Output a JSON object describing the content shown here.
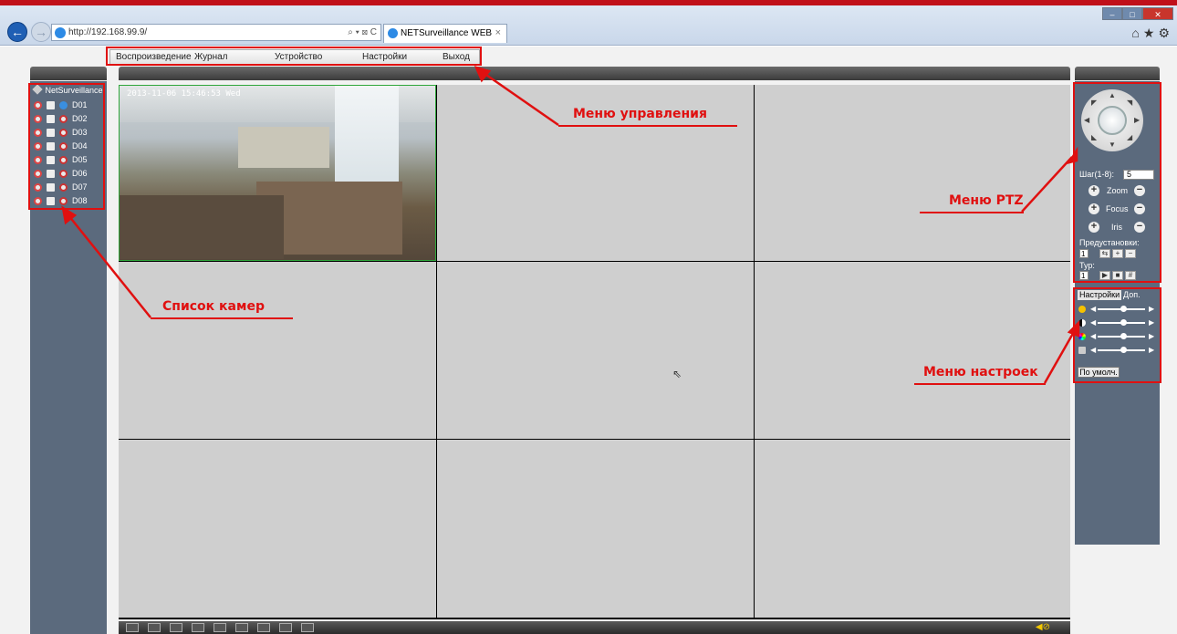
{
  "browser": {
    "url": "http://192.168.99.9/",
    "address_tools": "⌕ ▾ ⊠ C",
    "tab_title": "NETSurveillance WEB",
    "tab_close": "×"
  },
  "menu": {
    "items": [
      "Воспроизведение",
      "Журнал",
      "Устройство",
      "Настройки",
      "Выход"
    ]
  },
  "camera_tree": {
    "root_label": "NetSurveillance",
    "cameras": [
      "D01",
      "D02",
      "D03",
      "D04",
      "D05",
      "D06",
      "D07",
      "D08"
    ]
  },
  "video": {
    "osd_timestamp": "2013-11-06  15:46:53  Wed"
  },
  "ptz": {
    "step_label": "Шаг(1-8):",
    "step_value": "5",
    "zoom_label": "Zoom",
    "focus_label": "Focus",
    "iris_label": "Iris",
    "presets_label": "Предустановки:",
    "preset_value": "1",
    "tour_label": "Тур:",
    "tour_value": "1"
  },
  "settings": {
    "tab_settings": "Настройки",
    "tab_extra": "Доп.",
    "default_button": "По умолч."
  },
  "annotations": {
    "menu": "Меню управления",
    "ptz": "Меню PTZ",
    "cameras": "Список камер",
    "settings": "Меню настроек"
  },
  "colors": {
    "annotation": "#e01010",
    "panel": "#5b6a7d",
    "active_border": "#2fa63b"
  }
}
